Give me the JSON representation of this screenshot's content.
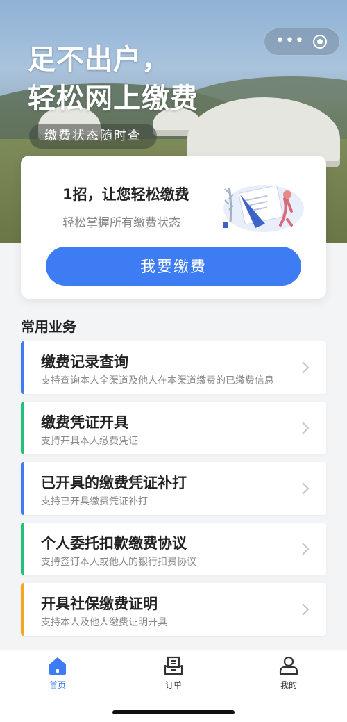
{
  "hero": {
    "title_line1": "足不出户，",
    "title_line2": "轻松网上缴费",
    "tag": "缴费状态随时查"
  },
  "capsule": {
    "more_icon": "more-dots-icon",
    "close_icon": "target-circle-icon"
  },
  "promo_card": {
    "title": "1招，让您轻松缴费",
    "subtitle": "轻松掌握所有缴费状态",
    "button": "我要缴费"
  },
  "section": {
    "title": "常用业务"
  },
  "services": [
    {
      "title": "缴费记录查询",
      "desc": "支持查询本人全渠道及他人在本渠道缴费的已缴费信息",
      "accent": "#3d7cf2"
    },
    {
      "title": "缴费凭证开具",
      "desc": "支持开具本人缴费凭证",
      "accent": "#22c07a"
    },
    {
      "title": "已开具的缴费凭证补打",
      "desc": "支持已开具缴费凭证补打",
      "accent": "#3d7cf2"
    },
    {
      "title": "个人委托扣款缴费协议",
      "desc": "支持签订本人或他人的银行扣费协议",
      "accent": "#22c07a"
    },
    {
      "title": "开具社保缴费证明",
      "desc": "支持本人及他人缴费证明开具",
      "accent": "#f5a623"
    }
  ],
  "tabbar": {
    "items": [
      {
        "label": "首页",
        "icon": "home-icon",
        "active": true
      },
      {
        "label": "订单",
        "icon": "order-icon",
        "active": false
      },
      {
        "label": "我的",
        "icon": "user-icon",
        "active": false
      }
    ],
    "active_color": "#3d7cf2"
  }
}
